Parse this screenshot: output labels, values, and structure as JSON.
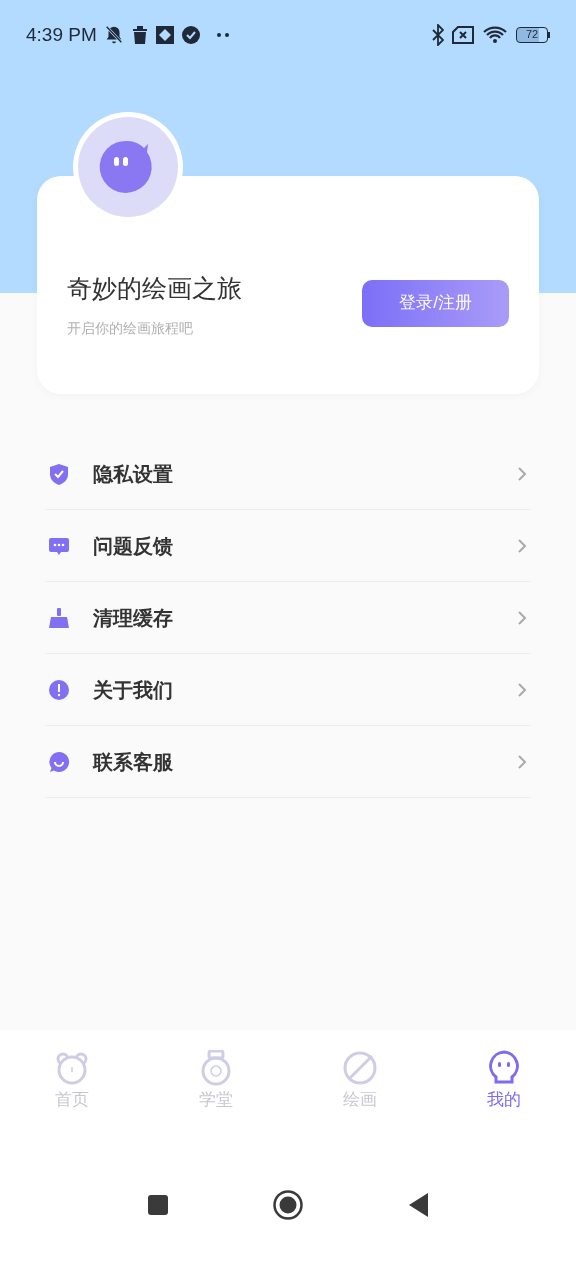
{
  "status_bar": {
    "time": "4:39 PM",
    "battery": "72"
  },
  "profile": {
    "title": "奇妙的绘画之旅",
    "subtitle": "开启你的绘画旅程吧",
    "button": "登录/注册"
  },
  "menu": [
    {
      "label": "隐私设置"
    },
    {
      "label": "问题反馈"
    },
    {
      "label": "清理缓存"
    },
    {
      "label": "关于我们"
    },
    {
      "label": "联系客服"
    }
  ],
  "tabs": [
    {
      "label": "首页",
      "selected": false
    },
    {
      "label": "学堂",
      "selected": false
    },
    {
      "label": "绘画",
      "selected": false
    },
    {
      "label": "我的",
      "selected": true
    }
  ]
}
